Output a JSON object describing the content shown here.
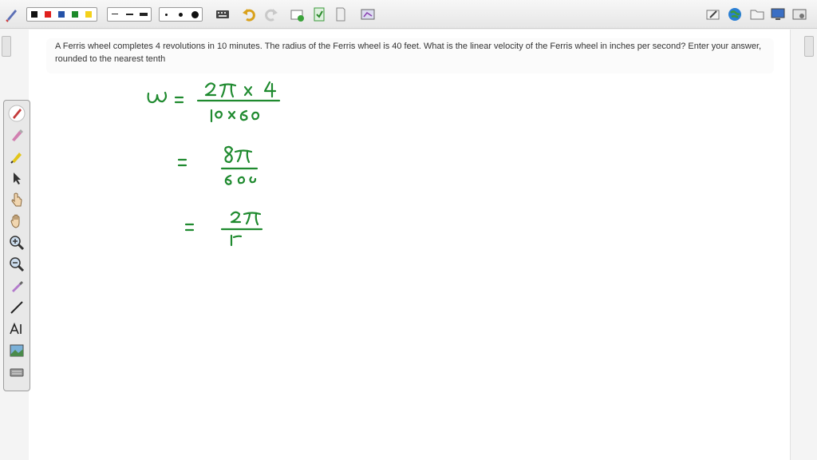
{
  "question": {
    "line1": "A Ferris wheel completes 4 revolutions in 10 minutes. The radius of the Ferris wheel is 40 feet. What is the linear velocity of the Ferris wheel in inches per second? Enter your answer,",
    "line2": "rounded to the nearest tenth"
  },
  "toolbar": {
    "colors": [
      "#111111",
      "#e0201e",
      "#2452a8",
      "#1d8a2a",
      "#f4d11a"
    ]
  },
  "ink": {
    "color": "#1f8a2f",
    "line1": {
      "lhs": "ω",
      "eq": "=",
      "num": "2π x 4",
      "den": "10 x 60"
    },
    "line2": {
      "eq": "=",
      "num": "8π",
      "den": "600"
    },
    "line3": {
      "eq": "=",
      "num": "2π",
      "den": "15"
    }
  }
}
